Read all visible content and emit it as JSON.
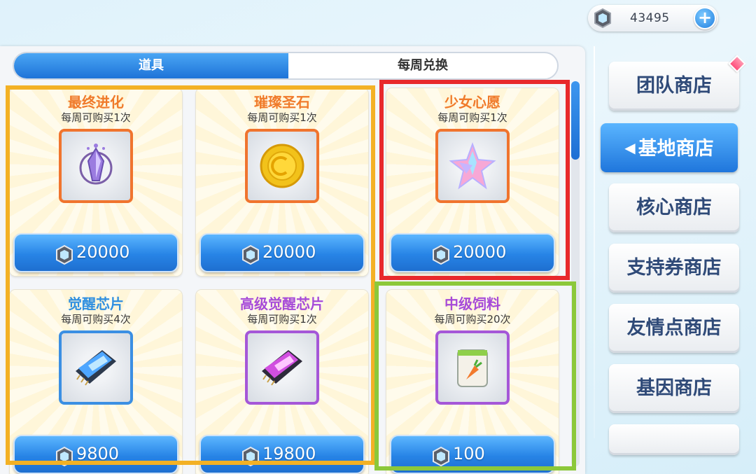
{
  "currency": {
    "amount": "43495"
  },
  "tabs": [
    {
      "label": "道具",
      "active": true
    },
    {
      "label": "每周兑换",
      "active": false
    }
  ],
  "items": [
    {
      "name": "最终进化",
      "limit": "每周可购买1次",
      "price": "20000",
      "name_color": "#f07a2a",
      "frame_color": "#f0742e",
      "icon": "evolution-crystal-icon"
    },
    {
      "name": "璀璨圣石",
      "limit": "每周可购买1次",
      "price": "20000",
      "name_color": "#f07a2a",
      "frame_color": "#f0742e",
      "icon": "gold-coin-icon"
    },
    {
      "name": "少女心愿",
      "limit": "每周可购买1次",
      "price": "20000",
      "name_color": "#f07a2a",
      "frame_color": "#f0742e",
      "icon": "star-crystal-icon"
    },
    {
      "name": "觉醒芯片",
      "limit": "每周可购买4次",
      "price": "9800",
      "name_color": "#2f8fe0",
      "frame_color": "#3b8fe3",
      "icon": "blue-chip-icon"
    },
    {
      "name": "高级觉醒芯片",
      "limit": "每周可购买1次",
      "price": "19800",
      "name_color": "#a64ad8",
      "frame_color": "#a557d8",
      "icon": "purple-chip-icon"
    },
    {
      "name": "中级饲料",
      "limit": "每周可购买20次",
      "price": "100",
      "name_color": "#a64ad8",
      "frame_color": "#a557d8",
      "icon": "feed-bag-icon"
    }
  ],
  "sidenav": [
    {
      "label": "团队商店",
      "active": false
    },
    {
      "label": "基地商店",
      "active": true
    },
    {
      "label": "核心商店",
      "active": false
    },
    {
      "label": "支持券商店",
      "active": false
    },
    {
      "label": "友情点商店",
      "active": false
    },
    {
      "label": "基因商店",
      "active": false
    },
    {
      "label": "",
      "active": false
    }
  ],
  "highlight_colors": {
    "orange": "#f3b125",
    "red": "#e8292c",
    "green": "#8cc83a"
  }
}
